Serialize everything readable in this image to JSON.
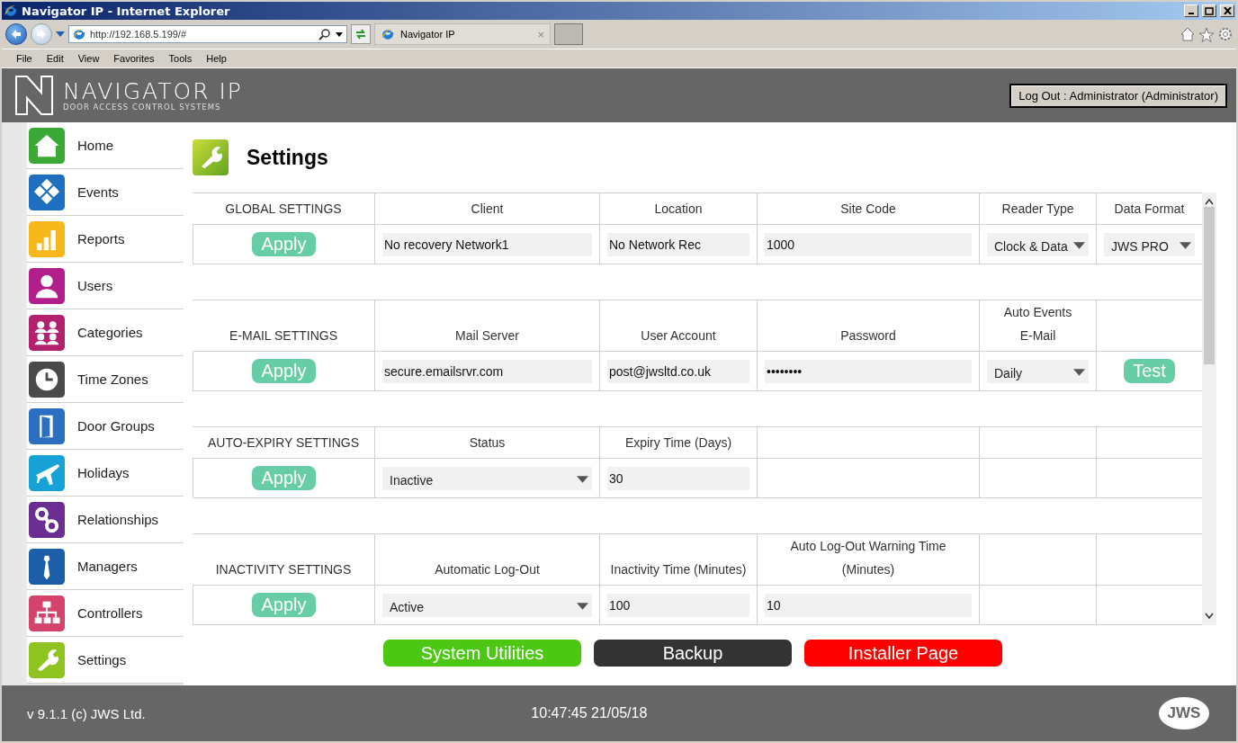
{
  "browser": {
    "title": "Navigator IP - Internet Explorer",
    "url": "http://192.168.5.199/#",
    "tab_title": "Navigator IP",
    "tab_close": "×",
    "menu": [
      "File",
      "Edit",
      "View",
      "Favorites",
      "Tools",
      "Help"
    ]
  },
  "header": {
    "logo_title": "NAVIGATOR IP",
    "logo_subtitle": "DOOR ACCESS CONTROL SYSTEMS",
    "logout": "Log Out : Administrator (Administrator)"
  },
  "sidebar": {
    "items": [
      {
        "label": "Home",
        "color": "#3aa935"
      },
      {
        "label": "Events",
        "color": "#1f6fc0"
      },
      {
        "label": "Reports",
        "color": "#f6b81a"
      },
      {
        "label": "Users",
        "color": "#b21f8c"
      },
      {
        "label": "Categories",
        "color": "#b3206e"
      },
      {
        "label": "Time Zones",
        "color": "#4a4a4a"
      },
      {
        "label": "Door Groups",
        "color": "#2a6fc2"
      },
      {
        "label": "Holidays",
        "color": "#16a2d6"
      },
      {
        "label": "Relationships",
        "color": "#6a2d91"
      },
      {
        "label": "Managers",
        "color": "#1d5ea8"
      },
      {
        "label": "Controllers",
        "color": "#d3436a"
      },
      {
        "label": "Settings",
        "color": "#8fc31f"
      }
    ]
  },
  "page": {
    "title": "Settings"
  },
  "sections": [
    {
      "heading": "GLOBAL SETTINGS",
      "apply": "Apply",
      "columns": [
        {
          "label": "Client",
          "kind": "text",
          "value": "No recovery Network1"
        },
        {
          "label": "Location",
          "kind": "text",
          "value": "No Network Rec"
        },
        {
          "label": "Site Code",
          "kind": "text",
          "value": "1000"
        },
        {
          "label": "Reader Type",
          "kind": "select",
          "value": "Clock & Data"
        },
        {
          "label": "Data Format",
          "kind": "select",
          "value": "JWS PRO"
        }
      ]
    },
    {
      "heading": "E-MAIL SETTINGS",
      "apply": "Apply",
      "columns": [
        {
          "label": "Mail Server",
          "kind": "text",
          "value": "secure.emailsrvr.com"
        },
        {
          "label": "User Account",
          "kind": "text",
          "value": "post@jwsltd.co.uk"
        },
        {
          "label": "Password",
          "kind": "password",
          "value": "••••••••"
        },
        {
          "label": "Auto Events E-Mail",
          "kind": "select",
          "value": "Daily"
        },
        {
          "kind": "button",
          "value": "Test"
        }
      ]
    },
    {
      "heading": "AUTO-EXPIRY SETTINGS",
      "apply": "Apply",
      "columns": [
        {
          "label": "Status",
          "kind": "select",
          "value": "Inactive"
        },
        {
          "label": "Expiry Time (Days)",
          "kind": "text",
          "value": "30"
        }
      ]
    },
    {
      "heading": "INACTIVITY SETTINGS",
      "apply": "Apply",
      "columns": [
        {
          "label": "Automatic Log-Out",
          "kind": "select",
          "value": "Active"
        },
        {
          "label": "Inactivity Time (Minutes)",
          "kind": "text",
          "value": "100"
        },
        {
          "label": "Auto Log-Out Warning Time (Minutes)",
          "kind": "text",
          "value": "10"
        }
      ]
    }
  ],
  "actions": [
    {
      "label": "System Utilities",
      "color": "#4cc814"
    },
    {
      "label": "Backup",
      "color": "#333333"
    },
    {
      "label": "Installer Page",
      "color": "#ff0000"
    }
  ],
  "footer": {
    "version": "v 9.1.1 (c) JWS Ltd.",
    "datetime": "10:47:45 21/05/18",
    "logo": "JWS"
  }
}
